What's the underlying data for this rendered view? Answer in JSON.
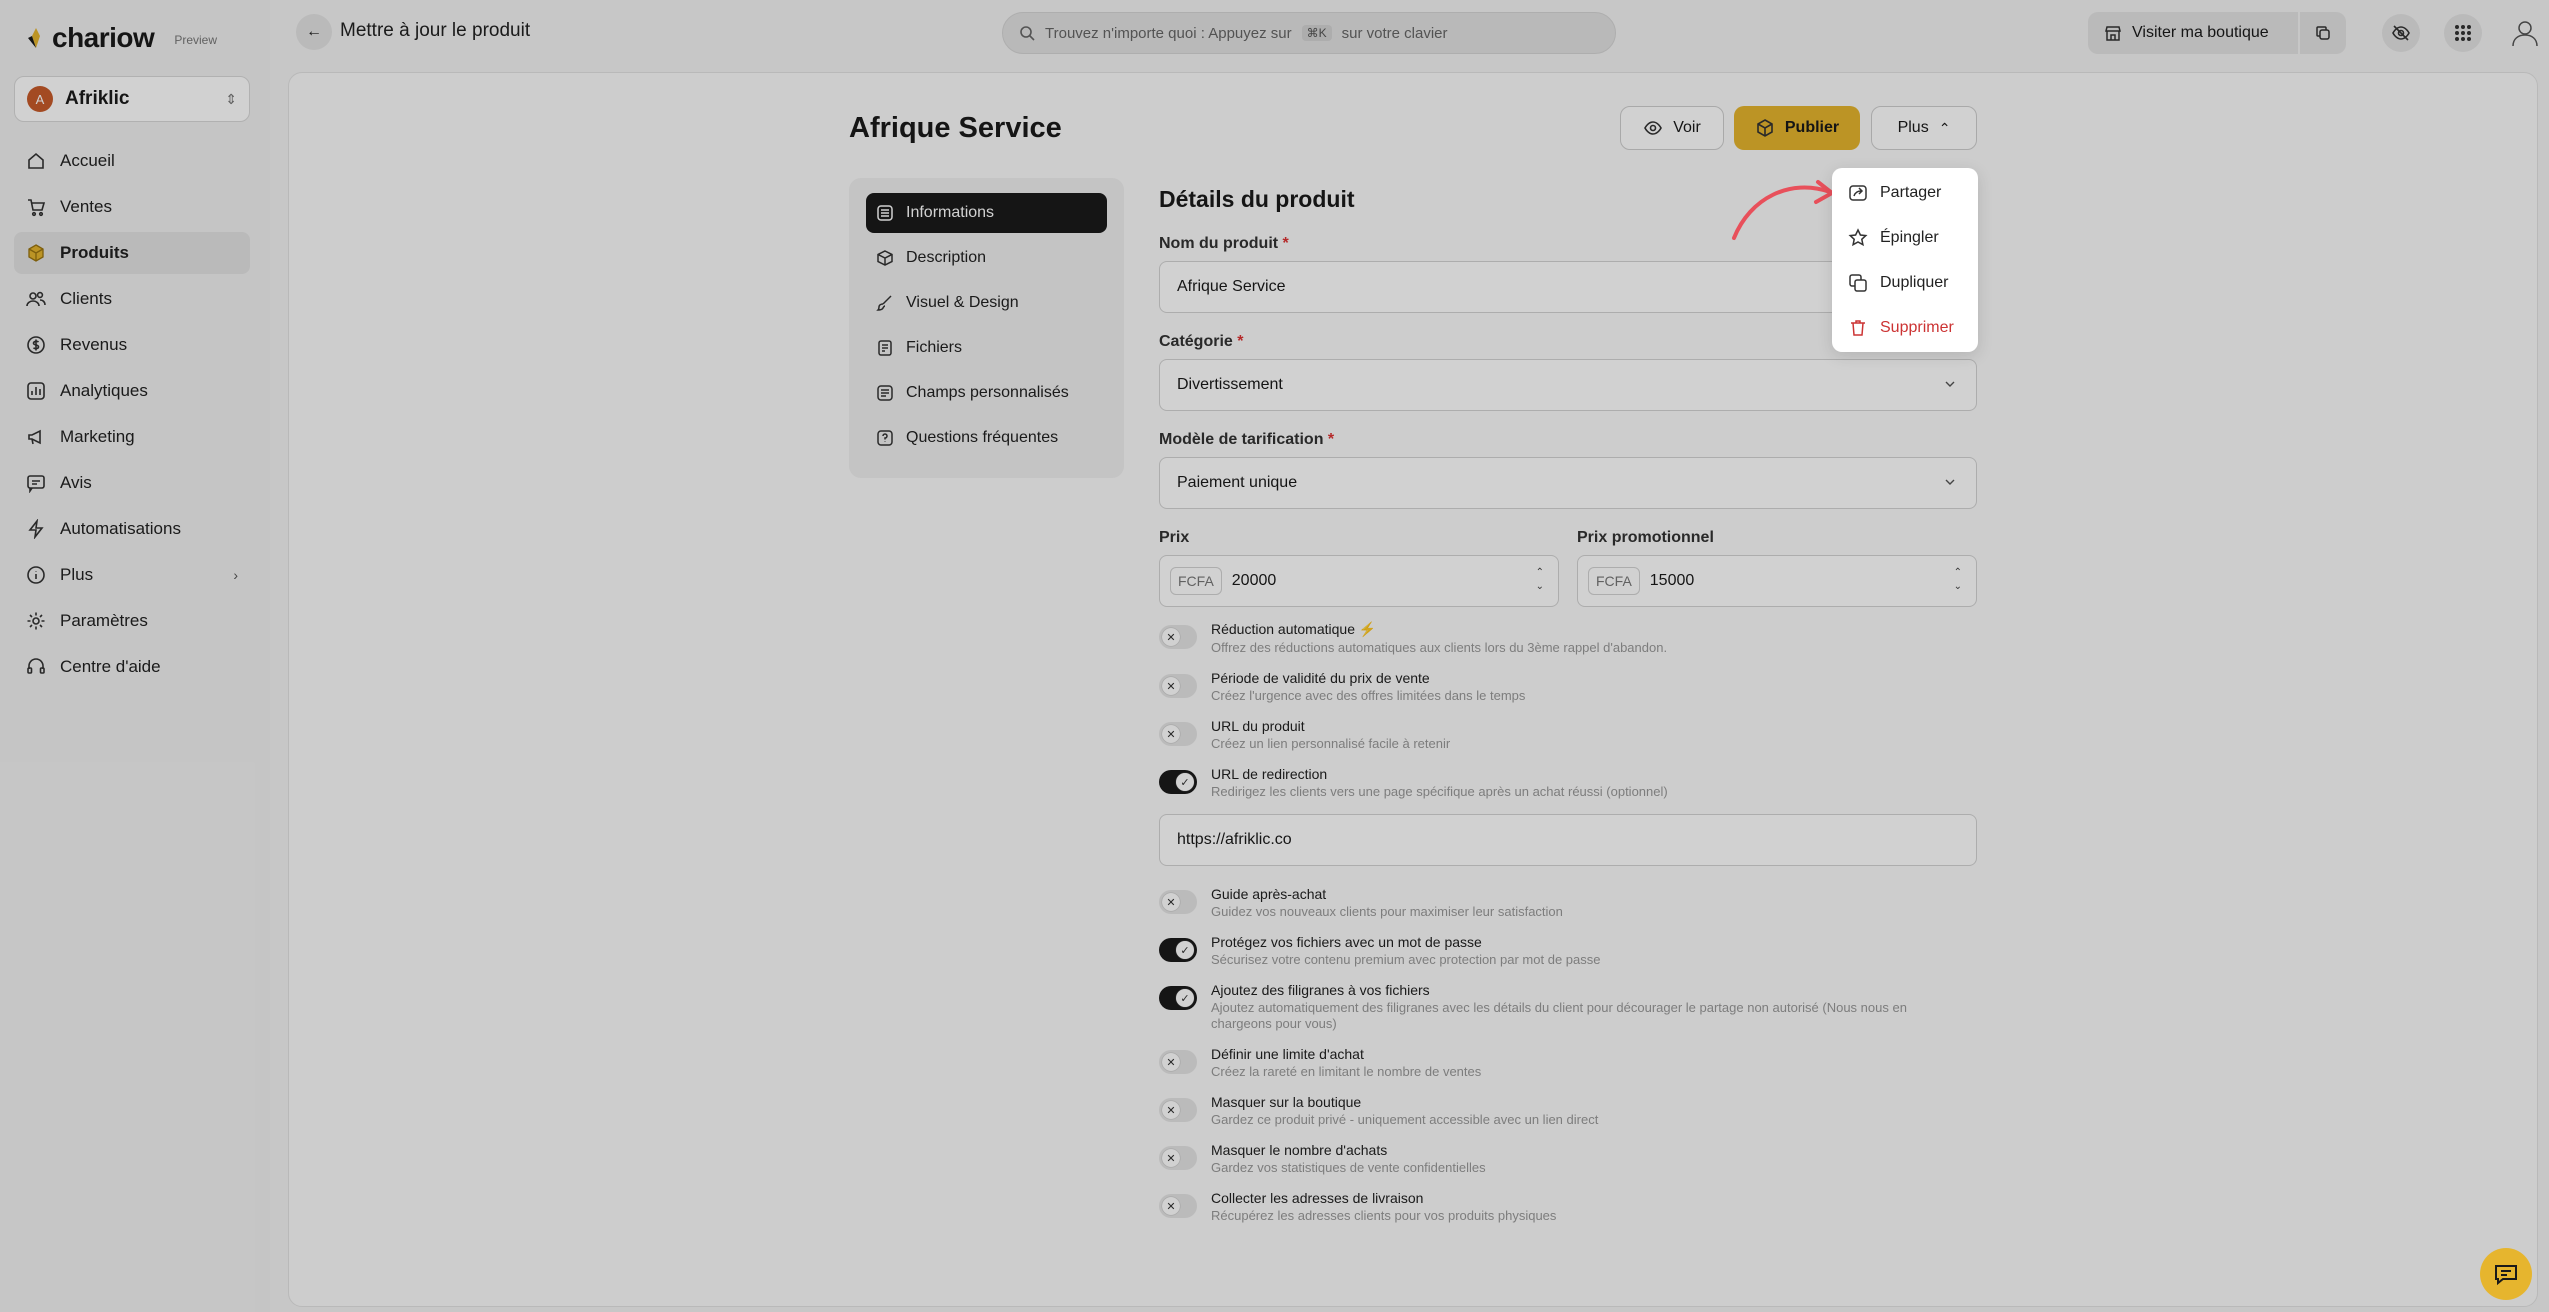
{
  "brand": {
    "name": "chariow",
    "tag": "Preview"
  },
  "store": {
    "name": "Afriklic",
    "initial": "A"
  },
  "nav": [
    {
      "label": "Accueil",
      "icon": "home-icon"
    },
    {
      "label": "Ventes",
      "icon": "cart-icon"
    },
    {
      "label": "Produits",
      "icon": "box-icon",
      "active": true
    },
    {
      "label": "Clients",
      "icon": "users-icon"
    },
    {
      "label": "Revenus",
      "icon": "money-icon"
    },
    {
      "label": "Analytiques",
      "icon": "chart-icon"
    },
    {
      "label": "Marketing",
      "icon": "megaphone-icon"
    },
    {
      "label": "Avis",
      "icon": "review-icon"
    },
    {
      "label": "Automatisations",
      "icon": "lightning-icon"
    },
    {
      "label": "Plus",
      "icon": "info-icon"
    },
    {
      "label": "Paramètres",
      "icon": "gear-icon"
    },
    {
      "label": "Centre d'aide",
      "icon": "headset-icon"
    }
  ],
  "topbar": {
    "title": "Mettre à jour le produit",
    "search_placeholder": "Trouvez n'importe quoi : Appuyez sur",
    "search_kbd": "⌘K",
    "search_suffix": "sur votre clavier",
    "visit": "Visiter ma boutique"
  },
  "product": {
    "title": "Afrique Service"
  },
  "actions": {
    "voir": "Voir",
    "publier": "Publier",
    "plus": "Plus"
  },
  "menu": [
    {
      "label": "Partager",
      "icon": "share-icon"
    },
    {
      "label": "Épingler",
      "icon": "star-icon"
    },
    {
      "label": "Dupliquer",
      "icon": "duplicate-icon"
    },
    {
      "label": "Supprimer",
      "icon": "trash-icon",
      "danger": true
    }
  ],
  "tabs": [
    {
      "label": "Informations",
      "active": true
    },
    {
      "label": "Description"
    },
    {
      "label": "Visuel & Design"
    },
    {
      "label": "Fichiers"
    },
    {
      "label": "Champs personnalisés"
    },
    {
      "label": "Questions fréquentes"
    }
  ],
  "form": {
    "section": "Détails du produit",
    "name_label": "Nom du produit",
    "name_value": "Afrique Service",
    "category_label": "Catégorie",
    "category_value": "Divertissement",
    "pricing_label": "Modèle de tarification",
    "pricing_value": "Paiement unique",
    "price_label": "Prix",
    "price_currency": "FCFA",
    "price_value": "20000",
    "promo_label": "Prix promotionnel",
    "promo_currency": "FCFA",
    "promo_value": "15000",
    "required_mark": "*",
    "redirect_url": "https://afriklic.co"
  },
  "toggles": [
    {
      "title": "Réduction automatique ⚡",
      "desc": "Offrez des réductions automatiques aux clients lors du 3ème rappel d'abandon.",
      "on": false
    },
    {
      "title": "Période de validité du prix de vente",
      "desc": "Créez l'urgence avec des offres limitées dans le temps",
      "on": false
    },
    {
      "title": "URL du produit",
      "desc": "Créez un lien personnalisé facile à retenir",
      "on": false
    },
    {
      "title": "URL de redirection",
      "desc": "Redirigez les clients vers une page spécifique après un achat réussi (optionnel)",
      "on": true
    },
    {
      "title": "Guide après-achat",
      "desc": "Guidez vos nouveaux clients pour maximiser leur satisfaction",
      "on": false
    },
    {
      "title": "Protégez vos fichiers avec un mot de passe",
      "desc": "Sécurisez votre contenu premium avec protection par mot de passe",
      "on": true
    },
    {
      "title": "Ajoutez des filigranes à vos fichiers",
      "desc": "Ajoutez automatiquement des filigranes avec les détails du client pour décourager le partage non autorisé (Nous nous en chargeons pour vous)",
      "on": true
    },
    {
      "title": "Définir une limite d'achat",
      "desc": "Créez la rareté en limitant le nombre de ventes",
      "on": false
    },
    {
      "title": "Masquer sur la boutique",
      "desc": "Gardez ce produit privé - uniquement accessible avec un lien direct",
      "on": false
    },
    {
      "title": "Masquer le nombre d'achats",
      "desc": "Gardez vos statistiques de vente confidentielles",
      "on": false
    },
    {
      "title": "Collecter les adresses de livraison",
      "desc": "Récupérez les adresses clients pour vos produits physiques",
      "on": false
    }
  ],
  "colors": {
    "accent": "#e6b52e",
    "danger": "#cc3333",
    "arrow": "#e8505b"
  }
}
